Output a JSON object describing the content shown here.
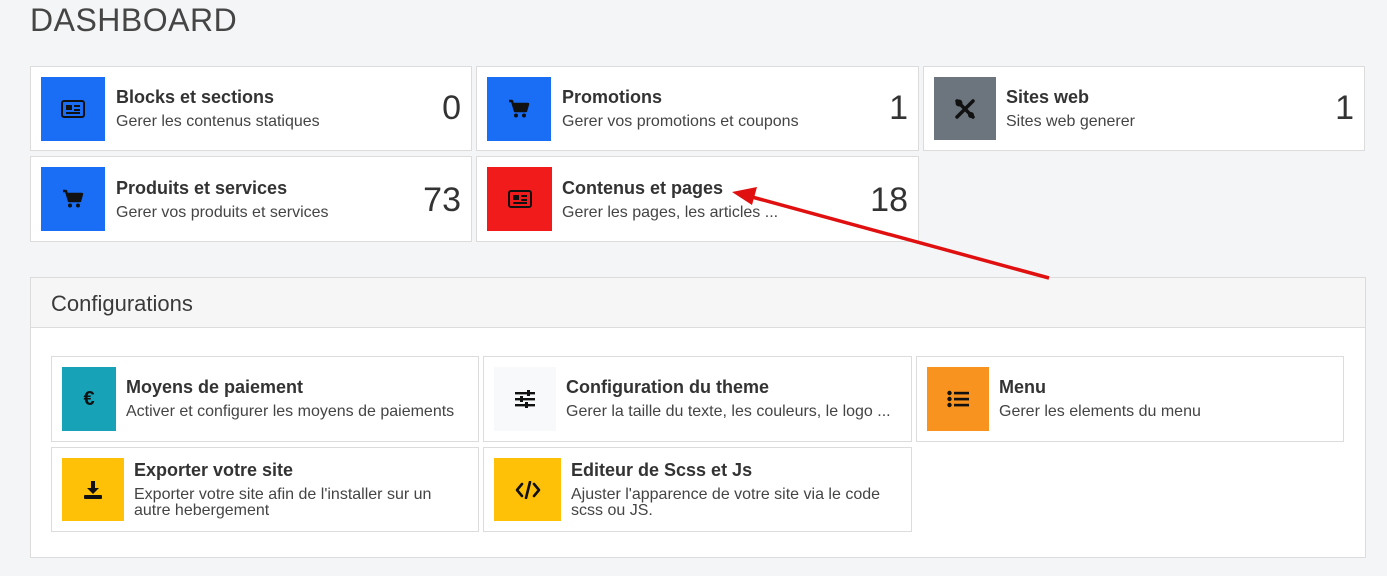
{
  "page": {
    "title": "DASHBOARD"
  },
  "colors": {
    "blue": "#1a6ef5",
    "gray": "#6c757d",
    "red": "#f21b1b",
    "teal": "#17a2b8",
    "light": "#f8f9fa",
    "orange": "#f7931e",
    "yellow": "#ffc107",
    "arrow": "#e01010"
  },
  "stats": [
    {
      "icon": "newspaper-icon",
      "title": "Blocks et sections",
      "description": "Gerer les contenus statiques",
      "count": "0"
    },
    {
      "icon": "cart-icon",
      "title": "Promotions",
      "description": "Gerer vos promotions et coupons",
      "count": "1"
    },
    {
      "icon": "tools-icon",
      "title": "Sites web",
      "description": "Sites web generer",
      "count": "1"
    },
    {
      "icon": "cart-icon",
      "title": "Produits et services",
      "description": "Gerer vos produits et services",
      "count": "73"
    },
    {
      "icon": "newspaper-icon",
      "title": "Contenus et pages",
      "description": "Gerer les pages, les articles ...",
      "count": "18"
    }
  ],
  "configurations": {
    "title": "Configurations",
    "items": [
      {
        "icon": "euro-icon",
        "title": "Moyens de paiement",
        "description": "Activer et configurer les moyens de paiements"
      },
      {
        "icon": "sliders-icon",
        "title": "Configuration du theme",
        "description": "Gerer la taille du texte, les couleurs, le logo ..."
      },
      {
        "icon": "list-icon",
        "title": "Menu",
        "description": "Gerer les elements du menu"
      },
      {
        "icon": "download-icon",
        "title": "Exporter votre site",
        "description": "Exporter votre site afin de l'installer sur un autre hebergement"
      },
      {
        "icon": "code-icon",
        "title": "Editeur de Scss et Js",
        "description": "Ajuster l'apparence de votre site via le code scss ou JS."
      }
    ]
  }
}
